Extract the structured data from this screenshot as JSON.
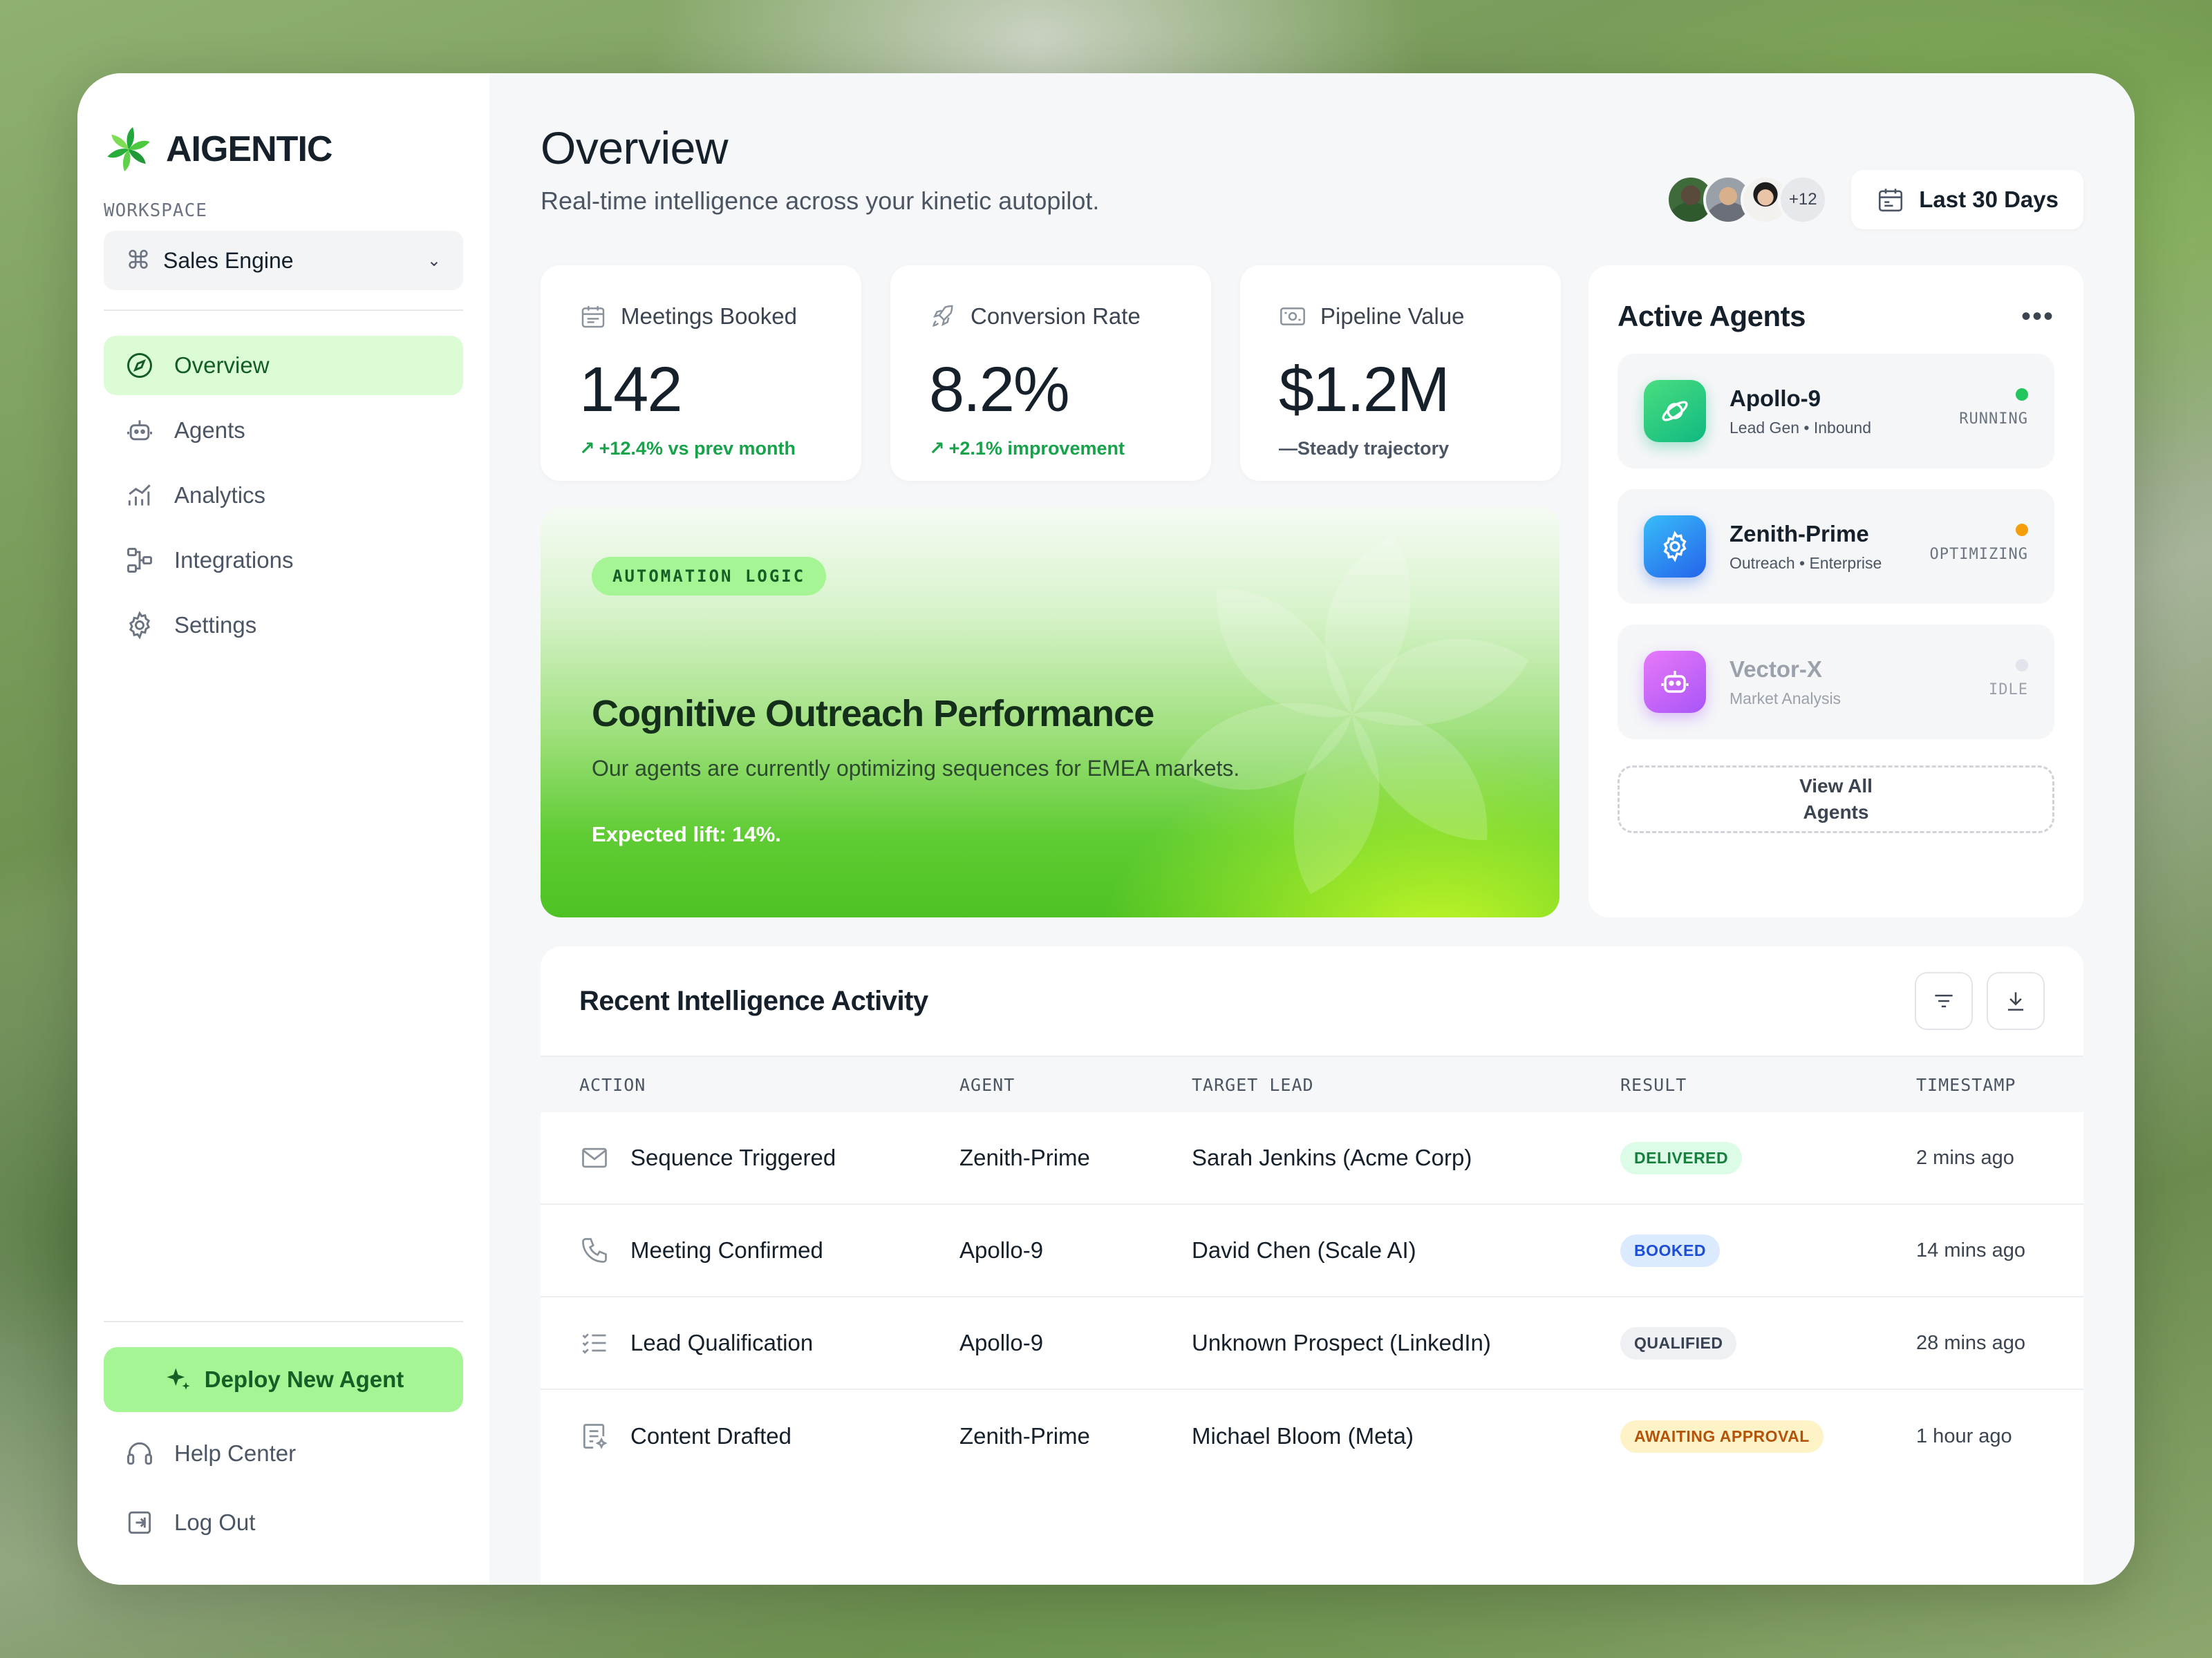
{
  "brand": {
    "name": "AIGENTIC"
  },
  "workspace": {
    "label": "WORKSPACE",
    "selected": "Sales Engine"
  },
  "nav": [
    {
      "label": "Overview",
      "icon": "compass-icon",
      "active": true
    },
    {
      "label": "Agents",
      "icon": "robot-icon"
    },
    {
      "label": "Analytics",
      "icon": "bar-chart-icon"
    },
    {
      "label": "Integrations",
      "icon": "integrations-icon"
    },
    {
      "label": "Settings",
      "icon": "gear-icon"
    }
  ],
  "sidebar_bottom": {
    "deploy": "Deploy New Agent",
    "help": "Help Center",
    "logout": "Log Out"
  },
  "header": {
    "title": "Overview",
    "subtitle": "Real-time intelligence across your kinetic autopilot.",
    "team_more": "+12",
    "date_range": "Last 30 Days"
  },
  "stats": [
    {
      "label": "Meetings Booked",
      "value": "142",
      "delta": "+12.4% vs prev month",
      "trend": "up"
    },
    {
      "label": "Conversion Rate",
      "value": "8.2%",
      "delta": "+2.1% improvement",
      "trend": "up"
    },
    {
      "label": "Pipeline Value",
      "value": "$1.2M",
      "delta": "—Steady trajectory",
      "trend": "flat"
    }
  ],
  "hero": {
    "tag": "AUTOMATION LOGIC",
    "title": "Cognitive Outreach Performance",
    "desc": "Our agents are currently optimizing sequences for EMEA markets.",
    "lift": "Expected lift: 14%."
  },
  "agents": {
    "title": "Active Agents",
    "list": [
      {
        "name": "Apollo-9",
        "meta": "Lead Gen • Inbound",
        "status": "RUNNING",
        "dot": "#22c55e"
      },
      {
        "name": "Zenith-Prime",
        "meta": "Outreach • Enterprise",
        "status": "OPTIMIZING",
        "dot": "#f59e0b"
      },
      {
        "name": "Vector-X",
        "meta": "Market Analysis",
        "status": "IDLE",
        "dot": "#e2e4ec"
      }
    ],
    "view_all": "View All Agents"
  },
  "activity": {
    "title": "Recent Intelligence Activity",
    "columns": [
      "ACTION",
      "AGENT",
      "TARGET LEAD",
      "RESULT",
      "TIMESTAMP"
    ],
    "rows": [
      {
        "action": "Sequence Triggered",
        "icon": "mail-icon",
        "agent": "Zenith-Prime",
        "lead": "Sarah Jenkins (Acme Corp)",
        "result": "DELIVERED",
        "time": "2 mins ago"
      },
      {
        "action": "Meeting Confirmed",
        "icon": "phone-icon",
        "agent": "Apollo-9",
        "lead": "David Chen (Scale AI)",
        "result": "BOOKED",
        "time": "14 mins ago"
      },
      {
        "action": "Lead Qualification",
        "icon": "checklist-icon",
        "agent": "Apollo-9",
        "lead": "Unknown Prospect (LinkedIn)",
        "result": "QUALIFIED",
        "time": "28 mins ago"
      },
      {
        "action": "Content Drafted",
        "icon": "document-edit-icon",
        "agent": "Zenith-Prime",
        "lead": "Michael Bloom (Meta)",
        "result": "AWAITING APPROVAL",
        "time": "1 hour ago"
      }
    ]
  },
  "colors": {
    "accent": "#a6f594",
    "accent_text": "#155e26",
    "delivered_bg": "#dcfce7",
    "delivered_fg": "#15803d",
    "booked_bg": "#dbeafe",
    "booked_fg": "#1d4ed8",
    "qualified_bg": "#eef0f3",
    "qualified_fg": "#374151",
    "awaiting_bg": "#fef3c7",
    "awaiting_fg": "#b45309"
  }
}
